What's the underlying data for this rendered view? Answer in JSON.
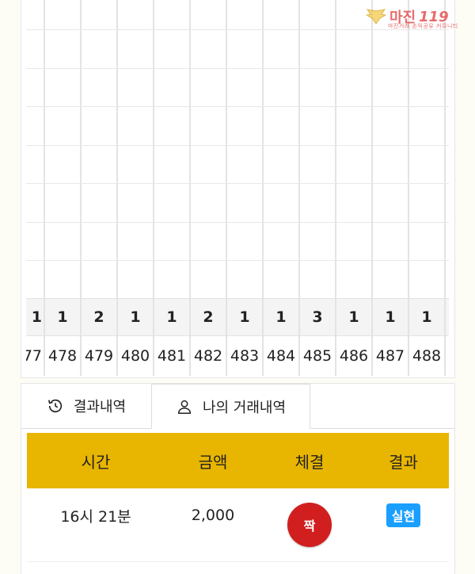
{
  "watermark": {
    "brand": "마진",
    "num": "119",
    "sub": "마진거래 손익공유 커뮤니티"
  },
  "counts": [
    "1",
    "1",
    "2",
    "1",
    "1",
    "2",
    "1",
    "1",
    "3",
    "1",
    "1",
    "1"
  ],
  "ids": [
    "77",
    "478",
    "479",
    "480",
    "481",
    "482",
    "483",
    "484",
    "485",
    "486",
    "487",
    "488"
  ],
  "tabs": [
    {
      "label": "결과내역",
      "icon": "history-icon"
    },
    {
      "label": "나의 거래내역",
      "icon": "user-icon"
    }
  ],
  "table": {
    "headers": [
      "시간",
      "금액",
      "체결",
      "결과"
    ],
    "rows": [
      {
        "time": "16시 21분",
        "amount": "2,000",
        "trade": "짝",
        "result": "실현"
      }
    ]
  },
  "colors": {
    "header": "#e8b500",
    "trade_badge": "#d11f1f",
    "result_badge": "#1a9fff"
  }
}
